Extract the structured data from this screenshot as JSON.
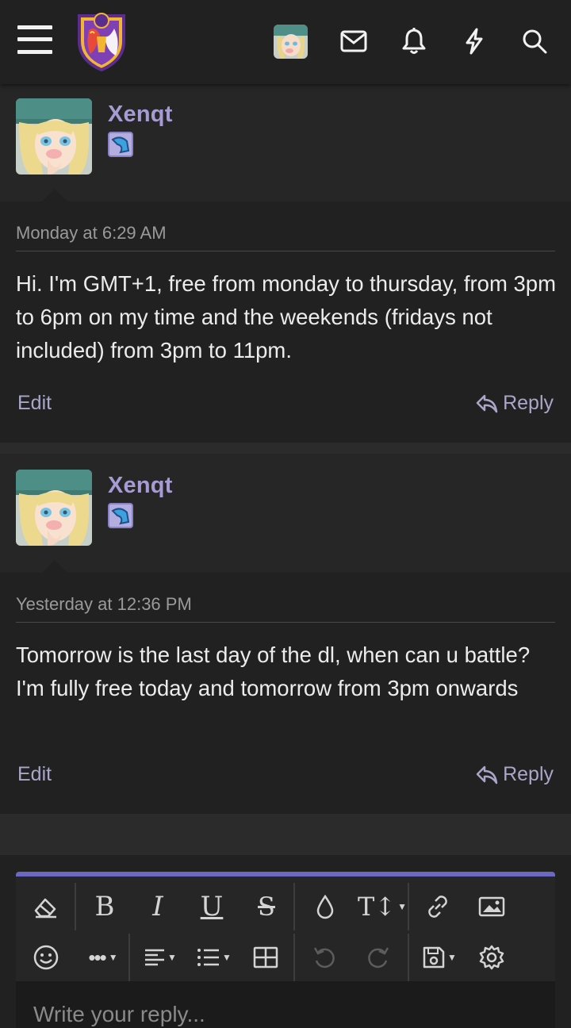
{
  "header": {
    "menu_icon": "hamburger-menu-icon",
    "logo_icon": "forum-crest-logo",
    "icons": [
      "user-avatar",
      "envelope-icon",
      "bell-icon",
      "lightning-icon",
      "search-icon"
    ]
  },
  "posts": [
    {
      "username": "Xenqt",
      "timestamp": "Monday at 6:29 AM",
      "message": "Hi. I'm GMT+1, free from monday to thursday, from 3pm to 6pm on my time and the weekends (fridays not included) from 3pm to 11pm.",
      "edit_label": "Edit",
      "reply_label": "Reply"
    },
    {
      "username": "Xenqt",
      "timestamp": "Yesterday at 12:36 PM",
      "message": "Tomorrow is the last day of the dl, when can u battle? I'm fully free today and tomorrow from 3pm onwards",
      "edit_label": "Edit",
      "reply_label": "Reply"
    }
  ],
  "editor": {
    "placeholder": "Write your reply...",
    "accent_color": "#6a68c0",
    "toolbar_row1": [
      "eraser-icon",
      "bold-icon",
      "italic-icon",
      "underline-icon",
      "strikethrough-icon",
      "text-color-icon",
      "text-size-icon",
      "link-icon",
      "image-icon"
    ],
    "toolbar_row2": [
      "emoji-icon",
      "more-options-icon",
      "align-icon",
      "list-icon",
      "table-icon",
      "undo-icon",
      "redo-icon",
      "save-draft-icon",
      "settings-icon"
    ]
  },
  "colors": {
    "username": "#a79bd4",
    "link": "#a9a6c9",
    "background": "#2b2b2c"
  }
}
